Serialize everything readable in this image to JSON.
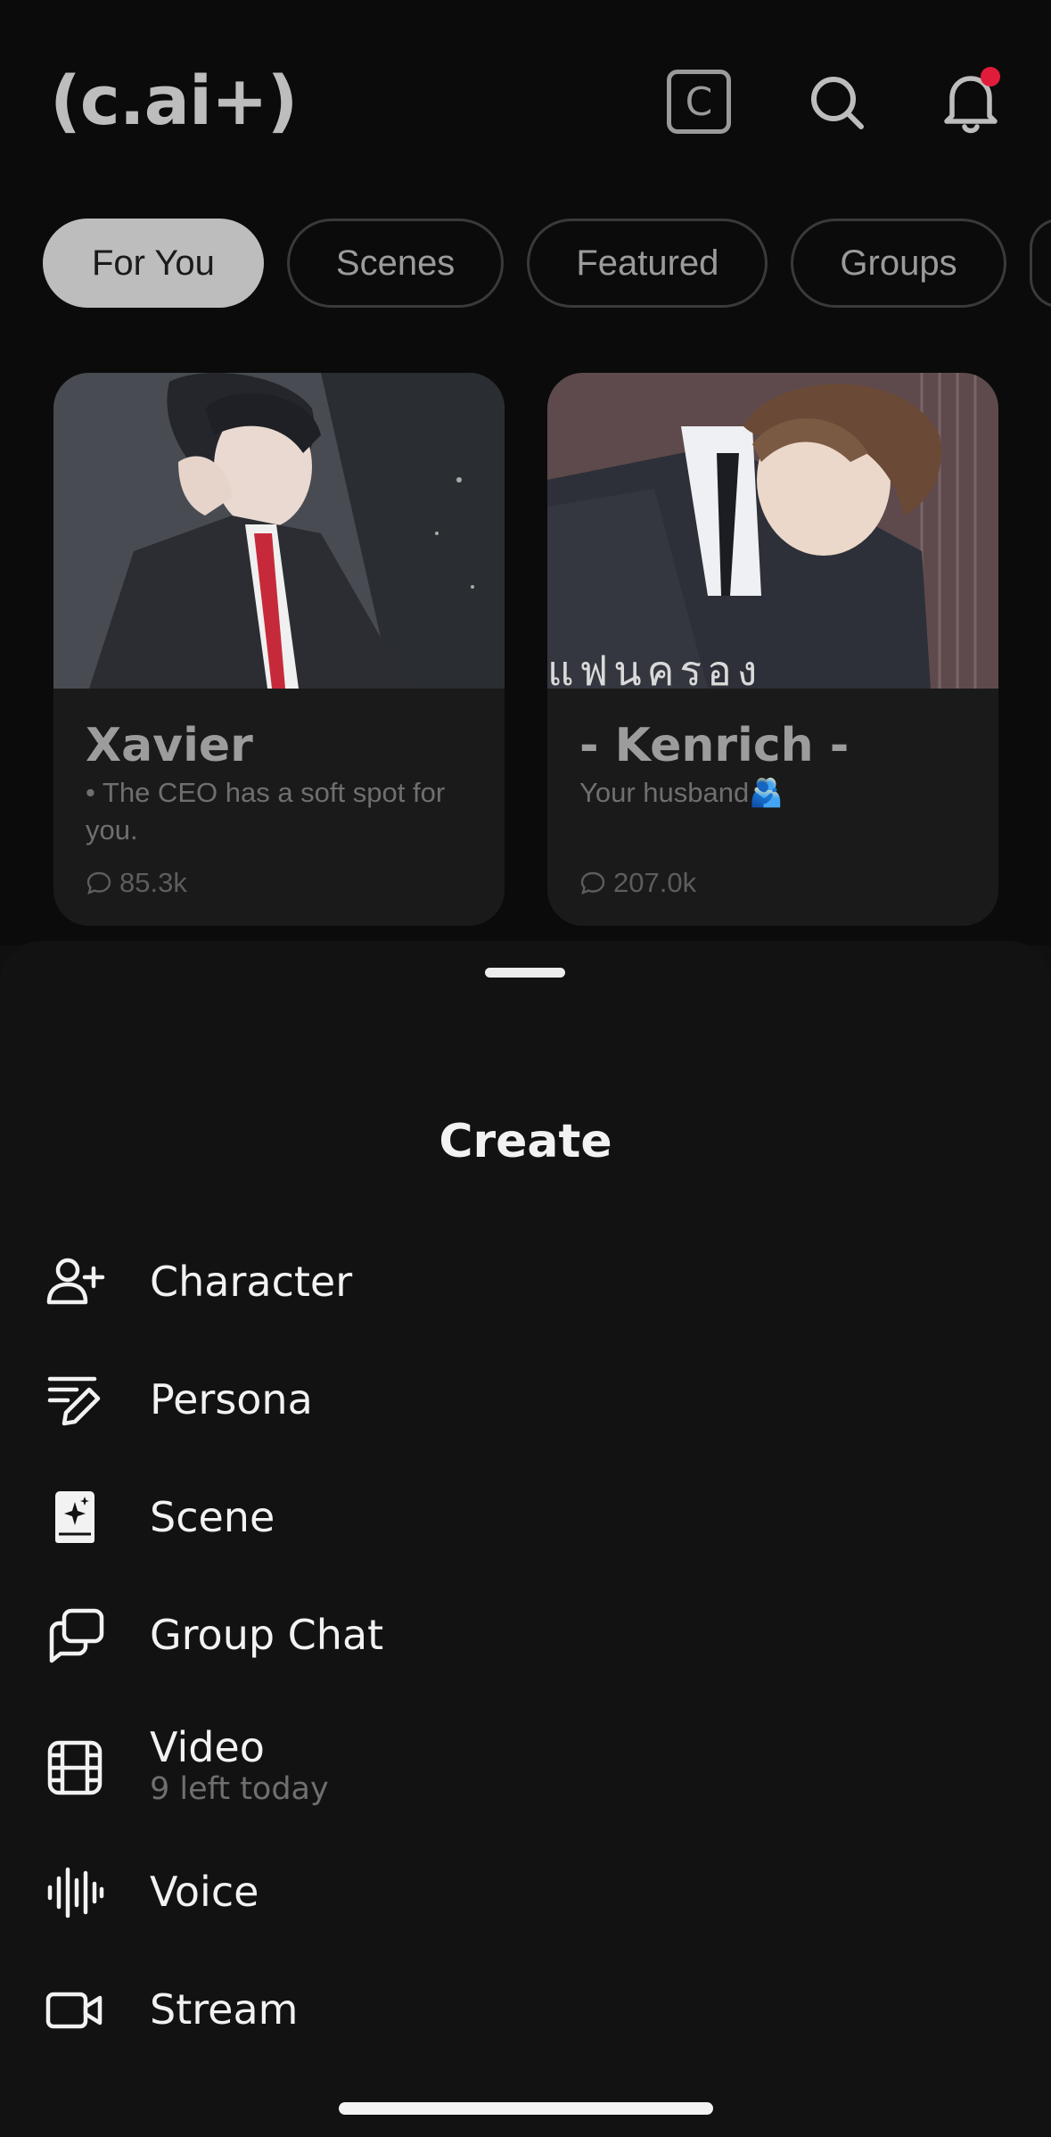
{
  "header": {
    "logo": "(c.ai+)",
    "c_badge": "C"
  },
  "tabs": [
    {
      "label": "For You",
      "active": true
    },
    {
      "label": "Scenes",
      "active": false
    },
    {
      "label": "Featured",
      "active": false
    },
    {
      "label": "Groups",
      "active": false
    }
  ],
  "cards": [
    {
      "name": "Xavier",
      "description": "• The CEO has a soft spot for you.",
      "chats": "85.3k"
    },
    {
      "name": "- Kenrich -",
      "description": "Your husband🫂",
      "chats": "207.0k",
      "image_caption": "แฟนครอง"
    }
  ],
  "sheet": {
    "title": "Create",
    "items": [
      {
        "label": "Character",
        "icon": "add-user-icon"
      },
      {
        "label": "Persona",
        "icon": "persona-edit-icon"
      },
      {
        "label": "Scene",
        "icon": "scene-book-icon"
      },
      {
        "label": "Group Chat",
        "icon": "group-chat-icon"
      },
      {
        "label": "Video",
        "sub": "9 left today",
        "icon": "film-icon"
      },
      {
        "label": "Voice",
        "icon": "voice-wave-icon"
      },
      {
        "label": "Stream",
        "icon": "video-camera-icon"
      }
    ]
  },
  "colors": {
    "notification_dot": "#e11b3a",
    "background": "#101011",
    "active_tab": "#bdbdbd"
  }
}
